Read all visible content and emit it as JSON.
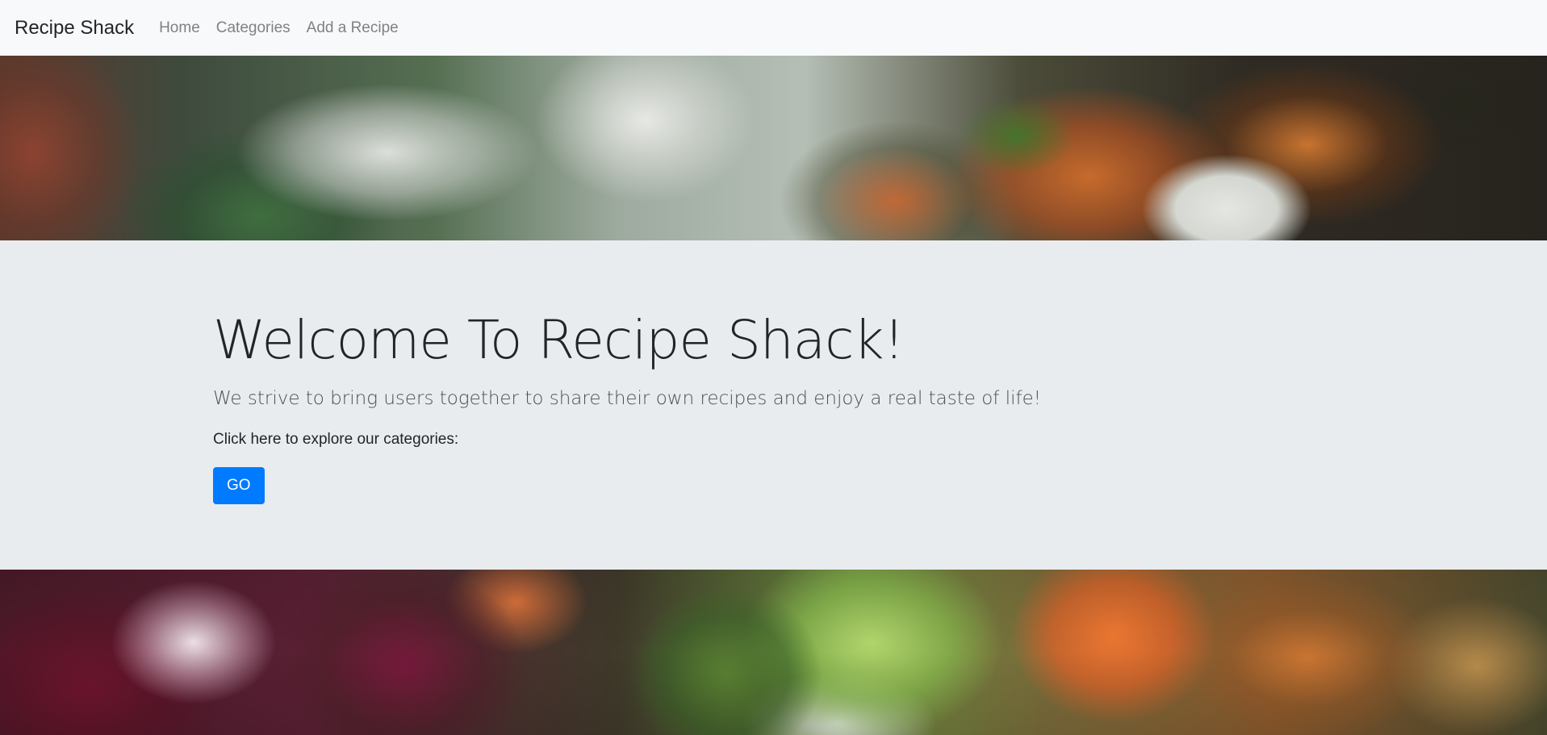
{
  "navbar": {
    "brand": "Recipe Shack",
    "links": [
      {
        "label": "Home"
      },
      {
        "label": "Categories"
      },
      {
        "label": "Add a Recipe"
      }
    ]
  },
  "jumbotron": {
    "title": "Welcome To Recipe Shack!",
    "lead": "We strive to bring users together to share their own recipes and enjoy a real taste of life!",
    "explore_text": "Click here to explore our categories:",
    "go_label": "GO"
  },
  "colors": {
    "navbar_bg": "#f8f9fa",
    "jumbotron_bg": "#e9ecef",
    "primary": "#007bff",
    "nav_link": "#7d8287",
    "text": "#212529"
  }
}
